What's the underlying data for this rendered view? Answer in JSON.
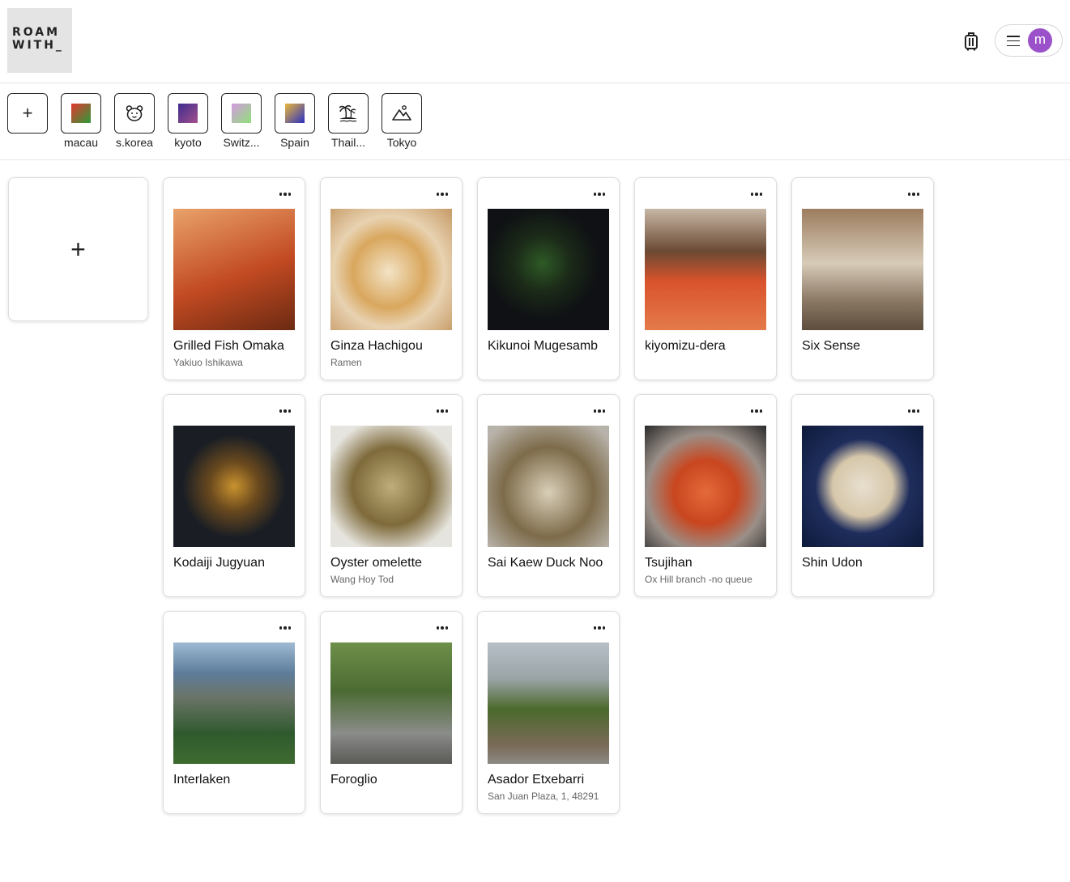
{
  "header": {
    "logo_line1": "ROAM",
    "logo_line2": "WITH_",
    "luggage_icon": "luggage-icon",
    "menu_icon": "hamburger-icon",
    "avatar_initial": "m",
    "avatar_color": "#9b51c9"
  },
  "collections": {
    "add_symbol": "+",
    "items": [
      {
        "label": "macau",
        "icon": "gradient-swatch",
        "colors": [
          "#e2382e",
          "#2e9a3a"
        ]
      },
      {
        "label": "s.korea",
        "icon": "bear-icon"
      },
      {
        "label": "kyoto",
        "icon": "gradient-swatch",
        "colors": [
          "#3e2c8f",
          "#a24f8c"
        ]
      },
      {
        "label": "Switz...",
        "icon": "gradient-swatch",
        "colors": [
          "#d59be0",
          "#8ee07a"
        ]
      },
      {
        "label": "Spain",
        "icon": "gradient-swatch",
        "colors": [
          "#e9b83a",
          "#2b2fc2"
        ]
      },
      {
        "label": "Thail...",
        "icon": "island-icon"
      },
      {
        "label": "Tokyo",
        "icon": "mountain-icon"
      }
    ]
  },
  "add_card_symbol": "+",
  "cards": [
    {
      "title": "Grilled Fish Omaka",
      "subtitle": "Yakiuo Ishikawa",
      "image": "grilled-fish-photo",
      "palette": [
        "#c24a22",
        "#e9a26a"
      ]
    },
    {
      "title": "Ginza Hachigou",
      "subtitle": "Ramen",
      "image": "ramen-photo",
      "palette": [
        "#d9a75e",
        "#f3e3c5"
      ]
    },
    {
      "title": "Kikunoi Mugesamb",
      "subtitle": "",
      "image": "green-tea-parfait-photo",
      "palette": [
        "#0f1114",
        "#2e5a26"
      ]
    },
    {
      "title": "kiyomizu-dera",
      "subtitle": "",
      "image": "temple-autumn-photo",
      "palette": [
        "#d9532c",
        "#c7b7a6"
      ]
    },
    {
      "title": "Six Sense",
      "subtitle": "",
      "image": "hotel-lounge-photo",
      "palette": [
        "#9c7c5e",
        "#d7cbb8"
      ]
    },
    {
      "title": "Kodaiji Jugyuan",
      "subtitle": "",
      "image": "tea-house-night-photo",
      "palette": [
        "#1a1e24",
        "#c9922e"
      ]
    },
    {
      "title": "Oyster omelette",
      "subtitle": "Wang Hoy Tod",
      "image": "oyster-omelette-photo",
      "palette": [
        "#7e6a3a",
        "#bfae7c"
      ]
    },
    {
      "title": "Sai Kaew Duck Noo",
      "subtitle": "",
      "image": "duck-noodle-photo",
      "palette": [
        "#7d6b4a",
        "#d9cfb8"
      ]
    },
    {
      "title": "Tsujihan",
      "subtitle": "Ox Hill branch -no queue",
      "image": "seafood-bowl-photo",
      "palette": [
        "#c9461f",
        "#2a2a2a"
      ]
    },
    {
      "title": "Shin Udon",
      "subtitle": "",
      "image": "udon-bowl-photo",
      "palette": [
        "#1f2d5c",
        "#e8dfcf"
      ]
    },
    {
      "title": "Interlaken",
      "subtitle": "",
      "image": "waterfall-cliff-photo",
      "palette": [
        "#5d7d9b",
        "#2f5a2e"
      ]
    },
    {
      "title": "Foroglio",
      "subtitle": "",
      "image": "village-waterfall-photo",
      "palette": [
        "#4c6b33",
        "#8a8c8a"
      ]
    },
    {
      "title": "Asador Etxebarri",
      "subtitle": "San Juan Plaza, 1, 48291",
      "image": "restaurant-facade-photo",
      "palette": [
        "#b7c0c7",
        "#4c6a2c"
      ]
    }
  ]
}
